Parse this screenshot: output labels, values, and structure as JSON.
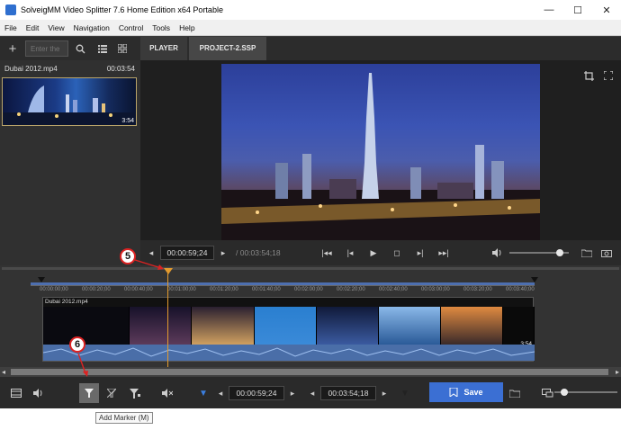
{
  "window": {
    "title": "SolveigMM Video Splitter 7.6 Home Edition x64 Portable",
    "minimize": "—",
    "maximize": "☐",
    "close": "✕"
  },
  "menu": [
    "File",
    "Edit",
    "View",
    "Navigation",
    "Control",
    "Tools",
    "Help"
  ],
  "toolbar": {
    "add_glyph": "+",
    "search_placeholder": "Enter the"
  },
  "tabs": [
    "PLAYER",
    "PROJECT-2.SSP"
  ],
  "file": {
    "name": "Dubai 2012.mp4",
    "duration": "00:03:54",
    "thumb_duration": "3:54"
  },
  "player": {
    "current_time": "00:00:59;24",
    "total_time": "/ 00:03:54;18",
    "volume": 0.85
  },
  "timeline": {
    "ticks": [
      "00:00:00;00",
      "00:00:20;00",
      "00:00:40;00",
      "00:01:00;00",
      "00:01:20;00",
      "00:01:40;00",
      "00:02:00;00",
      "00:02:20;00",
      "00:02:40;00",
      "00:03:00;00",
      "00:03:20;00",
      "00:03:40;00"
    ],
    "track_label": "Dubai 2012.mp4",
    "track_duration": "3:54"
  },
  "bottom": {
    "marker_in_time": "00:00:59;24",
    "marker_out_time": "00:03:54;18",
    "save_label": "Save",
    "zoom": 0.1
  },
  "callouts": [
    "5",
    "6"
  ],
  "tooltip": "Add Marker (M)",
  "colors": {
    "accent": "#3b6fd3",
    "playhead": "#e39b2e",
    "callout": "#d22222"
  }
}
